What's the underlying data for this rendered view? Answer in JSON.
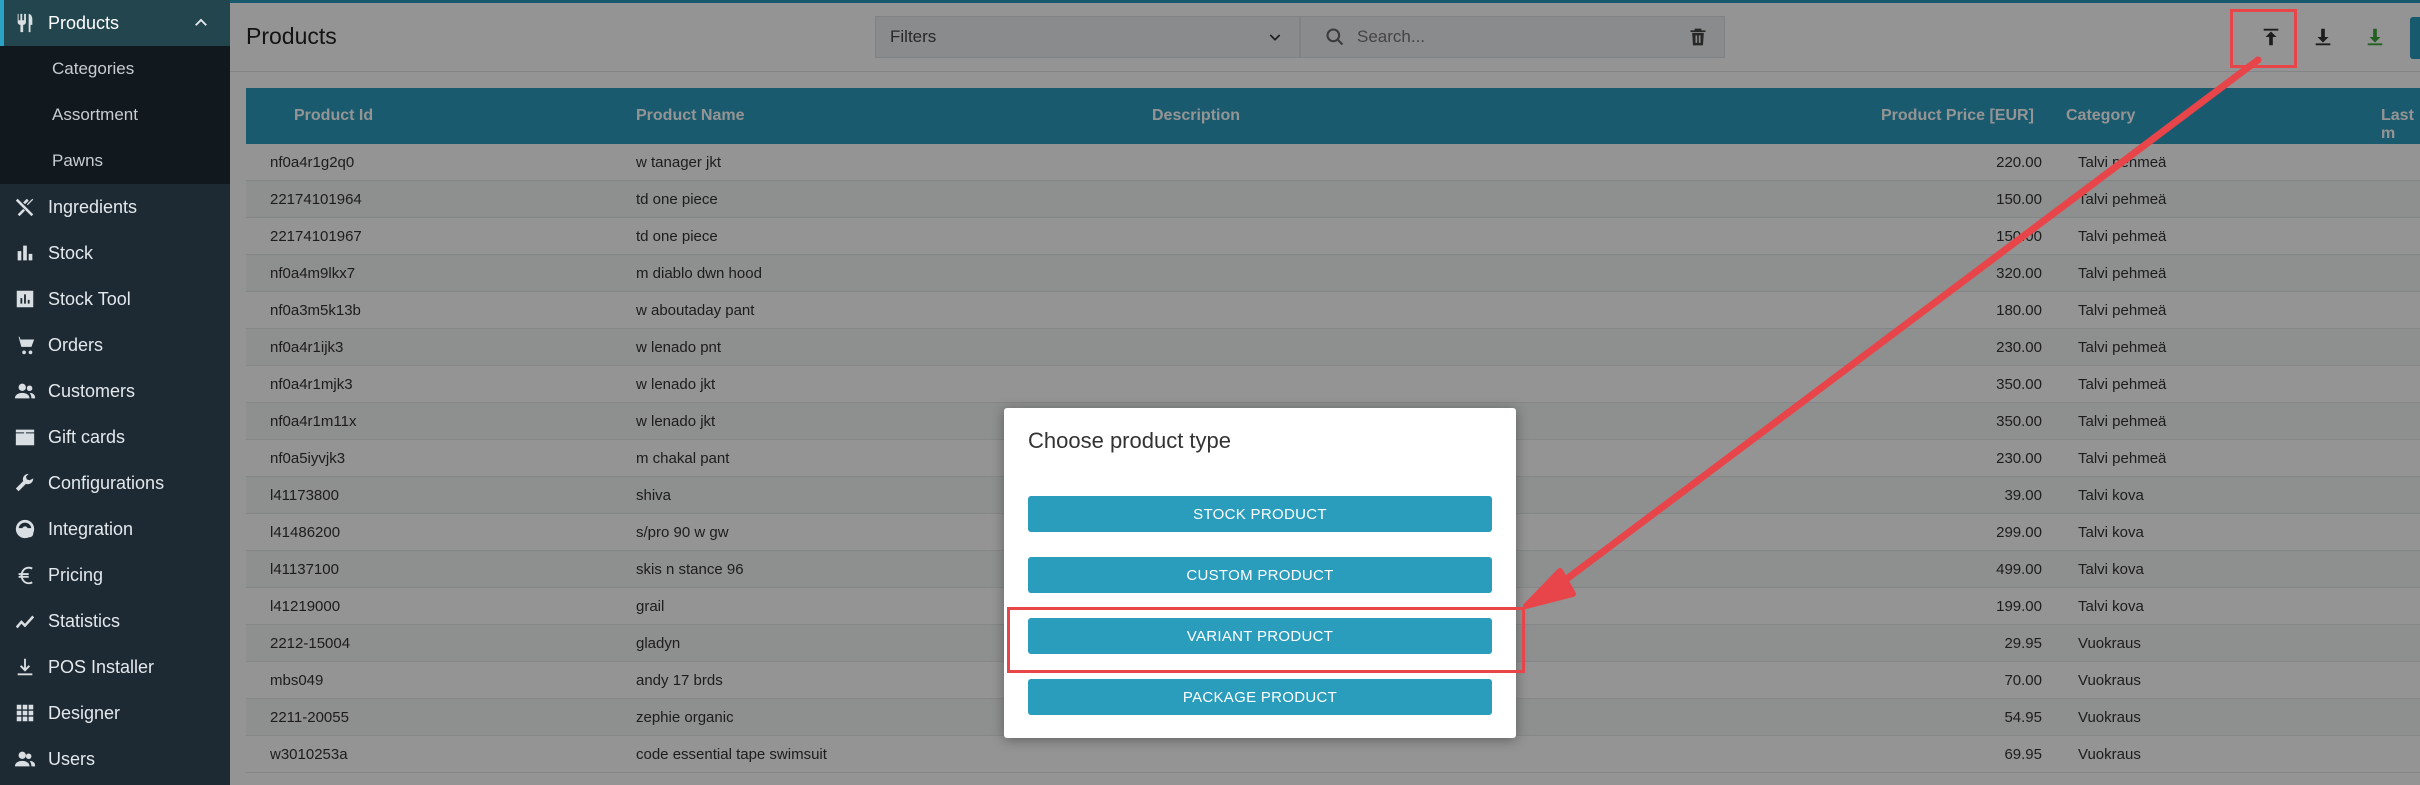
{
  "sidebar": {
    "items": [
      {
        "label": "Products",
        "icon": "fork-knife-icon",
        "active": true
      },
      {
        "label": "Ingredients",
        "icon": "utensils-cross-icon"
      },
      {
        "label": "Stock",
        "icon": "bar-chart-icon"
      },
      {
        "label": "Stock Tool",
        "icon": "chart-box-icon"
      },
      {
        "label": "Orders",
        "icon": "cart-icon"
      },
      {
        "label": "Customers",
        "icon": "people-icon"
      },
      {
        "label": "Gift cards",
        "icon": "gift-card-icon"
      },
      {
        "label": "Configurations",
        "icon": "wrench-icon"
      },
      {
        "label": "Integration",
        "icon": "globe-gear-icon"
      },
      {
        "label": "Pricing",
        "icon": "euro-icon"
      },
      {
        "label": "Statistics",
        "icon": "trend-line-icon"
      },
      {
        "label": "POS Installer",
        "icon": "download-icon"
      },
      {
        "label": "Designer",
        "icon": "grid-icon"
      },
      {
        "label": "Users",
        "icon": "users-icon"
      }
    ],
    "subitems": [
      "Categories",
      "Assortment",
      "Pawns"
    ]
  },
  "topbar": {
    "title": "Products",
    "filters_label": "Filters",
    "search_placeholder": "Search..."
  },
  "table": {
    "headers": [
      "Product Id",
      "Product Name",
      "Description",
      "Product Price [EUR]",
      "Category",
      "Last m"
    ],
    "rows": [
      [
        "nf0a4r1g2q0",
        "w tanager jkt",
        "",
        "220.00",
        "Talvi pehmeä"
      ],
      [
        "22174101964",
        "td one piece",
        "",
        "150.00",
        "Talvi pehmeä"
      ],
      [
        "22174101967",
        "td one piece",
        "",
        "150.00",
        "Talvi pehmeä"
      ],
      [
        "nf0a4m9lkx7",
        "m diablo dwn hood",
        "",
        "320.00",
        "Talvi pehmeä"
      ],
      [
        "nf0a3m5k13b",
        "w aboutaday pant",
        "",
        "180.00",
        "Talvi pehmeä"
      ],
      [
        "nf0a4r1ijk3",
        "w lenado pnt",
        "",
        "230.00",
        "Talvi pehmeä"
      ],
      [
        "nf0a4r1mjk3",
        "w lenado jkt",
        "",
        "350.00",
        "Talvi pehmeä"
      ],
      [
        "nf0a4r1m11x",
        "w lenado jkt",
        "",
        "350.00",
        "Talvi pehmeä"
      ],
      [
        "nf0a5iyvjk3",
        "m chakal pant",
        "",
        "230.00",
        "Talvi pehmeä"
      ],
      [
        "l41173800",
        "shiva",
        "",
        "39.00",
        "Talvi kova"
      ],
      [
        "l41486200",
        "s/pro 90 w gw",
        "",
        "299.00",
        "Talvi kova"
      ],
      [
        "l41137100",
        "skis n stance 96",
        "",
        "499.00",
        "Talvi kova"
      ],
      [
        "l41219000",
        "grail",
        "",
        "199.00",
        "Talvi kova"
      ],
      [
        "2212-15004",
        "gladyn",
        "",
        "29.95",
        "Vuokraus"
      ],
      [
        "mbs049",
        "andy 17 brds",
        "",
        "70.00",
        "Vuokraus"
      ],
      [
        "2211-20055",
        "zephie organic",
        "",
        "54.95",
        "Vuokraus"
      ],
      [
        "w3010253a",
        "code essential tape swimsuit",
        "",
        "69.95",
        "Vuokraus"
      ]
    ]
  },
  "modal": {
    "title": "Choose product type",
    "buttons": [
      "STOCK PRODUCT",
      "CUSTOM PRODUCT",
      "VARIANT PRODUCT",
      "PACKAGE PRODUCT"
    ]
  },
  "colors": {
    "accent": "#2a9cbc",
    "sidebar_bg": "#1d2a33",
    "annotation_red": "#e8454a"
  }
}
